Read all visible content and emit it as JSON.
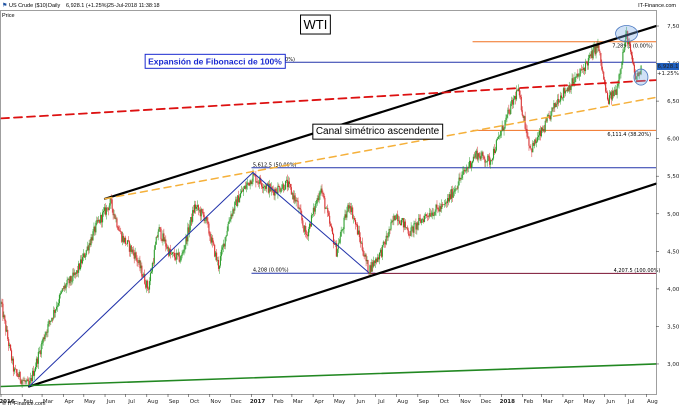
{
  "header": {
    "instrument": "US Crude ($10)",
    "interval": "Daily",
    "quote": "6,928.1 (+1.25%)",
    "timestamp": "25-Jul-2018 11:38:18",
    "source": "IT-Finance.com",
    "price_label": "Price",
    "footer_source": "© IT-Finance.com"
  },
  "chart_data": {
    "type": "candlestick",
    "title": "WTI",
    "xlabel": "",
    "ylabel": "",
    "x_range": [
      "2016-01-01",
      "2018-08-15"
    ],
    "ylim": [
      2600,
      7700
    ],
    "y_ticks": [
      3000,
      3500,
      4000,
      4500,
      5000,
      5500,
      6000,
      6500,
      7000,
      7500
    ],
    "y_tick_labels": [
      "3,000",
      "3,500",
      "4,000",
      "4,500",
      "5,000",
      "5,500",
      "6,000",
      "6,500",
      "7,000",
      "7,500"
    ],
    "x_ticks": [
      {
        "date": "2016-01-01",
        "label": "2016",
        "bold": true
      },
      {
        "date": "2016-02-01",
        "label": "Feb"
      },
      {
        "date": "2016-03-01",
        "label": "Mar"
      },
      {
        "date": "2016-04-01",
        "label": "Apr"
      },
      {
        "date": "2016-05-01",
        "label": "May"
      },
      {
        "date": "2016-06-01",
        "label": "Jun"
      },
      {
        "date": "2016-07-01",
        "label": "Jul"
      },
      {
        "date": "2016-08-01",
        "label": "Aug"
      },
      {
        "date": "2016-09-01",
        "label": "Sep"
      },
      {
        "date": "2016-10-01",
        "label": "Oct"
      },
      {
        "date": "2016-11-01",
        "label": "Nov"
      },
      {
        "date": "2016-12-01",
        "label": "Dec"
      },
      {
        "date": "2017-01-01",
        "label": "2017",
        "bold": true
      },
      {
        "date": "2017-02-01",
        "label": "Feb"
      },
      {
        "date": "2017-03-01",
        "label": "Mar"
      },
      {
        "date": "2017-04-01",
        "label": "Apr"
      },
      {
        "date": "2017-05-01",
        "label": "May"
      },
      {
        "date": "2017-06-01",
        "label": "Jun"
      },
      {
        "date": "2017-07-01",
        "label": "Jul"
      },
      {
        "date": "2017-08-01",
        "label": "Aug"
      },
      {
        "date": "2017-09-01",
        "label": "Sep"
      },
      {
        "date": "2017-10-01",
        "label": "Oct"
      },
      {
        "date": "2017-11-01",
        "label": "Nov"
      },
      {
        "date": "2017-12-01",
        "label": "Dec"
      },
      {
        "date": "2018-01-01",
        "label": "2018",
        "bold": true
      },
      {
        "date": "2018-02-01",
        "label": "Feb"
      },
      {
        "date": "2018-03-01",
        "label": "Mar"
      },
      {
        "date": "2018-04-01",
        "label": "Apr"
      },
      {
        "date": "2018-05-01",
        "label": "May"
      },
      {
        "date": "2018-06-01",
        "label": "Jun"
      },
      {
        "date": "2018-07-01",
        "label": "Jul"
      },
      {
        "date": "2018-08-01",
        "label": "Aug"
      }
    ],
    "price_path": [
      [
        "2016-01-01",
        3800
      ],
      [
        "2016-01-20",
        2900
      ],
      [
        "2016-02-11",
        2700
      ],
      [
        "2016-03-05",
        3400
      ],
      [
        "2016-04-01",
        4000
      ],
      [
        "2016-04-20",
        4200
      ],
      [
        "2016-05-20",
        4850
      ],
      [
        "2016-06-09",
        5150
      ],
      [
        "2016-06-25",
        4700
      ],
      [
        "2016-07-15",
        4450
      ],
      [
        "2016-08-03",
        4000
      ],
      [
        "2016-08-18",
        4800
      ],
      [
        "2016-09-05",
        4450
      ],
      [
        "2016-09-20",
        4400
      ],
      [
        "2016-10-10",
        5100
      ],
      [
        "2016-10-25",
        4950
      ],
      [
        "2016-11-14",
        4300
      ],
      [
        "2016-11-30",
        4950
      ],
      [
        "2016-12-15",
        5250
      ],
      [
        "2017-01-03",
        5500
      ],
      [
        "2017-02-01",
        5300
      ],
      [
        "2017-02-22",
        5400
      ],
      [
        "2017-03-08",
        5150
      ],
      [
        "2017-03-22",
        4700
      ],
      [
        "2017-04-12",
        5350
      ],
      [
        "2017-05-05",
        4500
      ],
      [
        "2017-05-24",
        5150
      ],
      [
        "2017-06-21",
        4250
      ],
      [
        "2017-07-10",
        4500
      ],
      [
        "2017-07-31",
        5000
      ],
      [
        "2017-08-20",
        4750
      ],
      [
        "2017-09-15",
        5000
      ],
      [
        "2017-10-10",
        5100
      ],
      [
        "2017-11-01",
        5450
      ],
      [
        "2017-11-25",
        5800
      ],
      [
        "2017-12-15",
        5700
      ],
      [
        "2018-01-25",
        6650
      ],
      [
        "2018-02-13",
        5850
      ],
      [
        "2018-03-05",
        6150
      ],
      [
        "2018-03-26",
        6550
      ],
      [
        "2018-04-10",
        6700
      ],
      [
        "2018-04-25",
        6850
      ],
      [
        "2018-05-22",
        7250
      ],
      [
        "2018-06-05",
        6500
      ],
      [
        "2018-06-18",
        6650
      ],
      [
        "2018-07-03",
        7400
      ],
      [
        "2018-07-16",
        6800
      ],
      [
        "2018-07-25",
        6928
      ]
    ],
    "current_price": {
      "label": "6,928.1",
      "change": "+1.25%",
      "value": 6928
    },
    "trendlines": [
      {
        "name": "channel-upper",
        "color": "#000000",
        "width": 2.2,
        "dash": "",
        "from": [
          "2016-06-01",
          5200
        ],
        "to": [
          "2018-08-15",
          7500
        ]
      },
      {
        "name": "channel-lower",
        "color": "#000000",
        "width": 2.2,
        "dash": "",
        "from": [
          "2016-02-11",
          2700
        ],
        "to": [
          "2018-08-15",
          5400
        ]
      },
      {
        "name": "long-term-support",
        "color": "#228822",
        "width": 1.6,
        "dash": "",
        "from": [
          "2016-01-01",
          2700
        ],
        "to": [
          "2018-08-15",
          3000
        ]
      },
      {
        "name": "red-resistance",
        "color": "#dd1111",
        "width": 1.8,
        "dash": "8,5",
        "from": [
          "2016-01-01",
          6270
        ],
        "to": [
          "2018-08-15",
          6780
        ]
      },
      {
        "name": "orange-support",
        "color": "#f5b03a",
        "width": 1.5,
        "dash": "7,5",
        "from": [
          "2016-06-01",
          5200
        ],
        "to": [
          "2018-08-15",
          6550
        ]
      },
      {
        "name": "fib-leg-1",
        "color": "#2233aa",
        "width": 1.0,
        "dash": "",
        "from": [
          "2016-02-11",
          2700
        ],
        "to": [
          "2017-01-03",
          5550
        ]
      },
      {
        "name": "fib-leg-2",
        "color": "#2233aa",
        "width": 1.0,
        "dash": "",
        "from": [
          "2017-01-03",
          5550
        ],
        "to": [
          "2017-06-21",
          4220
        ]
      }
    ],
    "levels": [
      {
        "name": "fib-100",
        "value": 7017,
        "label": "7,017 (100.00%)",
        "color": "#2233aa",
        "from": "2017-01-01",
        "to": "2018-08-15",
        "label_date": "2017-01-03",
        "label_side": "above"
      },
      {
        "name": "fib-50",
        "value": 5612.5,
        "label": "5,612.5 (50.00%)",
        "color": "#2233aa",
        "from": "2017-01-01",
        "to": "2018-08-15",
        "label_date": "2017-01-03",
        "label_side": "above"
      },
      {
        "name": "fib-0",
        "value": 4208,
        "label": "4,208 (0.00%)",
        "color": "#2233aa",
        "from": "2017-01-01",
        "to": "2017-07-01",
        "label_date": "2017-01-03",
        "label_side": "above"
      },
      {
        "name": "fib2-100",
        "value": 4207,
        "label": "4,207.5 (100.00%)",
        "color": "#7a1030",
        "from": "2017-06-21",
        "to": "2018-08-15",
        "label_date": "2018-06-14",
        "label_side": "above"
      },
      {
        "name": "fib2-0",
        "value": 7290,
        "label": "7,289.3 (0.00%)",
        "color": "#f07020",
        "from": "2017-11-20",
        "to": "2018-08-15",
        "label_date": "2018-06-12",
        "label_side": "below"
      },
      {
        "name": "fib2-38",
        "value": 6111,
        "label": "6,111.4 (38.20%)",
        "color": "#f07020",
        "from": "2017-11-20",
        "to": "2018-08-15",
        "label_date": "2018-06-05",
        "label_side": "below"
      }
    ],
    "callouts": [
      {
        "name": "title-callout",
        "text": "WTI",
        "date": "2017-03-18",
        "price": 7460,
        "size": 13,
        "border": "#000000",
        "color": "#000000",
        "bold": false
      },
      {
        "name": "fib-callout",
        "text": "Expansión de Fibonacci de 100%",
        "date": "2016-08-03",
        "price": 6990,
        "size": 8.5,
        "border": "#1a2ad0",
        "color": "#1a2ad0",
        "bold": true
      },
      {
        "name": "channel-callout",
        "text": "Canal simétrico ascendente",
        "date": "2017-04-05",
        "price": 6060,
        "size": 10,
        "border": "#000000",
        "color": "#000000",
        "bold": false
      }
    ],
    "highlights": [
      {
        "name": "peak-highlight",
        "date": "2018-07-03",
        "price": 7400,
        "rx": 11,
        "ry": 8
      },
      {
        "name": "current-highlight",
        "date": "2018-07-24",
        "price": 6820,
        "rx": 7,
        "ry": 8
      }
    ],
    "grid": false,
    "legend": "none",
    "colors": {
      "up": "#2e9e2e",
      "down": "#d83030",
      "axis": "#444444"
    }
  }
}
